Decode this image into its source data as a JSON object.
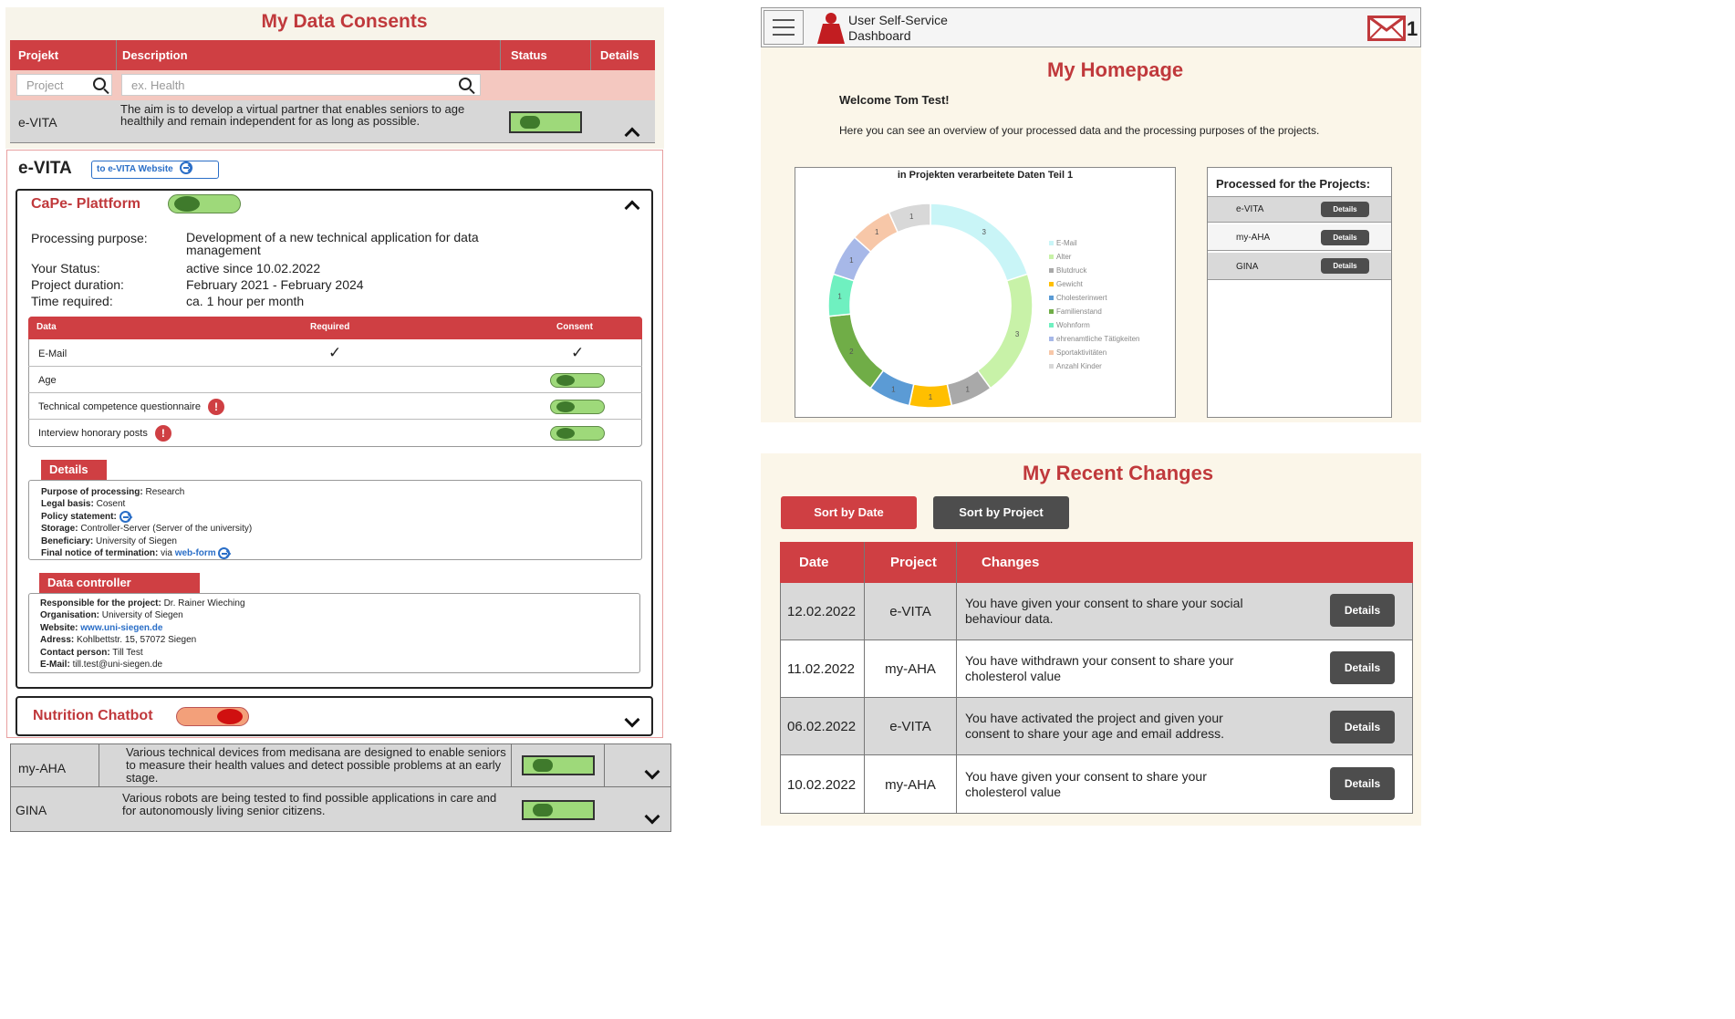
{
  "left": {
    "title": "My Data Consents",
    "table": {
      "headers": [
        "Projekt",
        "Description",
        "Status",
        "Details"
      ],
      "filter_project_placeholder": "Project",
      "filter_desc_placeholder": "ex. Health",
      "evita_name": "e-VITA",
      "evita_desc": "The aim is to develop a virtual partner that enables seniors to age healthily and remain independent for as long as possible."
    },
    "project": {
      "name": "e-VITA",
      "website_label": "to e-VITA Website",
      "platform": "CaPe- Plattform",
      "info": [
        {
          "label": "Processing purpose:",
          "value": "Development of a new technical application for data management"
        },
        {
          "label": "Your Status:",
          "value": "active since 10.02.2022"
        },
        {
          "label": "Project duration:",
          "value": "February 2021 - February 2024"
        },
        {
          "label": "Time required:",
          "value": "ca. 1 hour per month"
        }
      ],
      "data_headers": [
        "Data",
        "Required",
        "Consent"
      ],
      "data_rows": [
        {
          "label": "E-Mail",
          "required": "✓",
          "consent": "✓"
        },
        {
          "label": "Age"
        },
        {
          "label": "Technical competence questionnaire",
          "info": "!"
        },
        {
          "label": "Interview honorary posts",
          "info": "!"
        }
      ],
      "details_title": "Details",
      "details": [
        {
          "k": "Purpose of processing:",
          "v": "Research"
        },
        {
          "k": "Legal basis:",
          "v": "Cosent"
        },
        {
          "k": "Policy statement:",
          "v": ""
        },
        {
          "k": "Storage:",
          "v": "Controller-Server (Server of the university)"
        },
        {
          "k": "Beneficiary:",
          "v": "University of Siegen"
        },
        {
          "k": "Final notice of termination:",
          "v": "via ",
          "link": "web-form"
        }
      ],
      "controller_title": "Data controller",
      "controller": [
        {
          "k": "Responsible for the project:",
          "v": "Dr. Rainer Wieching"
        },
        {
          "k": "Organisation:",
          "v": "University of Siegen"
        },
        {
          "k": "Website:",
          "v": "",
          "link": "www.uni-siegen.de"
        },
        {
          "k": "Adress:",
          "v": "Kohlbettstr. 15, 57072 Siegen"
        },
        {
          "k": "Contact person:",
          "v": "Till Test"
        },
        {
          "k": "E-Mail:",
          "v": "till.test@uni-siegen.de"
        }
      ],
      "chatbot": "Nutrition Chatbot"
    },
    "other_projects": [
      {
        "name": "my-AHA",
        "desc": "Various technical devices from medisana are designed to enable seniors to measure their health values and detect possible problems at an early stage."
      },
      {
        "name": "GINA",
        "desc": "Various robots are being tested to find possible applications in care and for autonomously living senior citizens."
      }
    ]
  },
  "right": {
    "header_title_line1": "User Self-Service",
    "header_title_line2": "Dashboard",
    "mail_count": "1",
    "homepage_title": "My Homepage",
    "welcome": "Welcome Tom Test!",
    "intro": "Here you can see an overview of your processed data and the processing purposes of the projects.",
    "chart_title": "in Projekten verarbeitete Daten Teil 1",
    "processed_title": "Processed for the Projects:",
    "processed_projects": [
      "e-VITA",
      "my-AHA",
      "GINA"
    ],
    "details_label": "Details",
    "changes_title": "My Recent Changes",
    "sort_date": "Sort by Date",
    "sort_project": "Sort by Project",
    "changes_headers": [
      "Date",
      "Project",
      "Changes"
    ],
    "changes": [
      {
        "date": "12.02.2022",
        "project": "e-VITA",
        "text": "You have given your consent to share your social behaviour data."
      },
      {
        "date": "11.02.2022",
        "project": "my-AHA",
        "text": "You have withdrawn your consent to share your cholesterol value"
      },
      {
        "date": "06.02.2022",
        "project": "e-VITA",
        "text": "You have activated the project and given your consent to share your age and email address."
      },
      {
        "date": "10.02.2022",
        "project": "my-AHA",
        "text": "You have given your consent to share your cholesterol value"
      }
    ]
  },
  "chart_data": {
    "type": "pie",
    "title": "in Projekten verarbeitete Daten Teil 1",
    "categories": [
      "E-Mail",
      "Alter",
      "Blutdruck",
      "Gewicht",
      "Cholesterinwert",
      "Familienstand",
      "Wohnform",
      "ehrenamtliche Tätigkeiten",
      "Sportaktivitäten",
      "Anzahl Kinder"
    ],
    "values": [
      3,
      3,
      1,
      1,
      1,
      2,
      1,
      1,
      1,
      1
    ],
    "colors": [
      "#c9f5f7",
      "#c8f2a8",
      "#a9a9a9",
      "#ffbf00",
      "#5b9bd5",
      "#70ad47",
      "#6ff0c0",
      "#a7b8e8",
      "#f7c7a8",
      "#d8d8d8"
    ],
    "legend": "right"
  }
}
